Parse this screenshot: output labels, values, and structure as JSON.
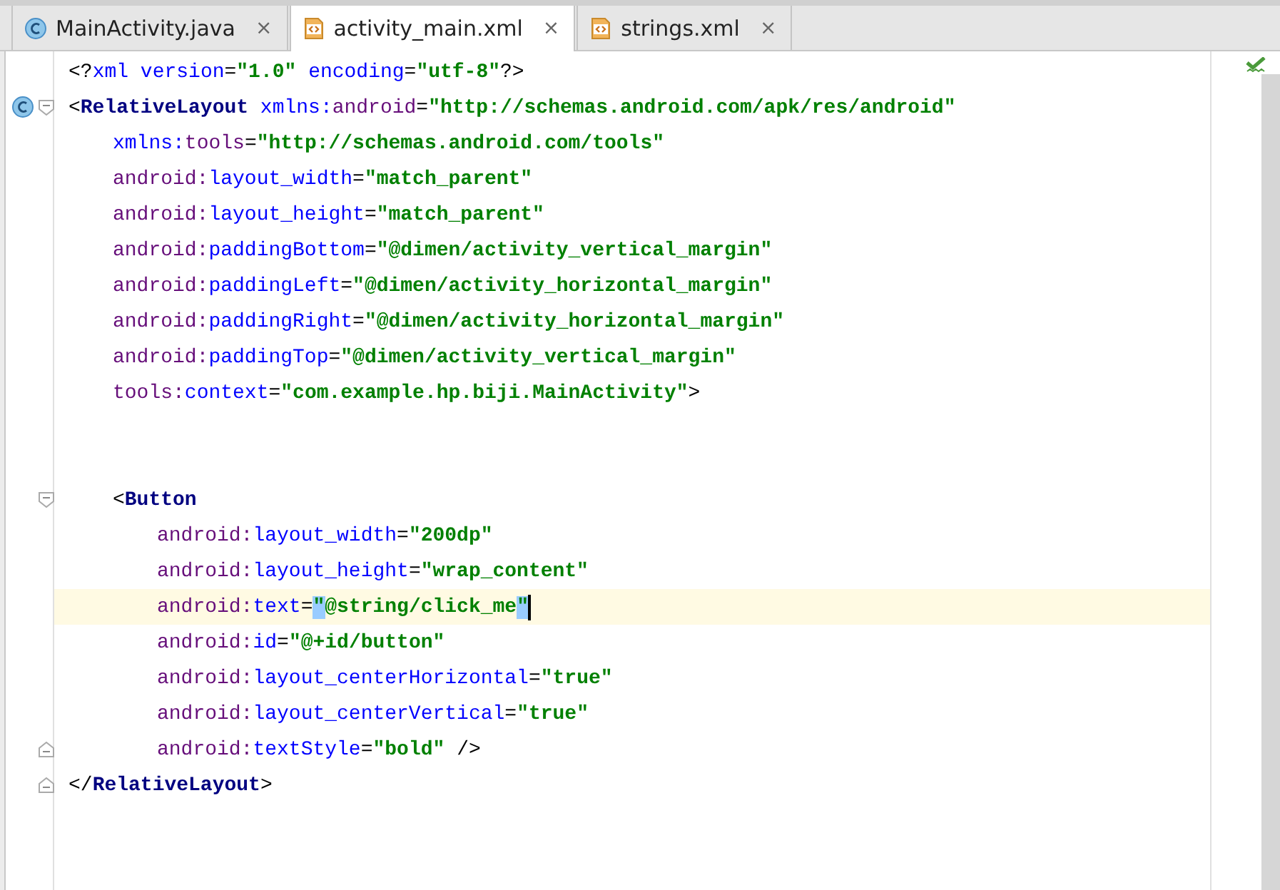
{
  "tabs": [
    {
      "label": "MainActivity.java",
      "kind": "java",
      "selected": false,
      "close": "×"
    },
    {
      "label": "activity_main.xml",
      "kind": "xml",
      "selected": true,
      "close": "×"
    },
    {
      "label": "strings.xml",
      "kind": "xml",
      "selected": false,
      "close": "×"
    }
  ],
  "editor": {
    "lines": [
      {
        "kind": "plain",
        "current": false,
        "tokens": [
          {
            "kind": "punct",
            "text": "<?"
          },
          {
            "kind": "attr",
            "text": "xml"
          },
          {
            "kind": "attr",
            "text": " version"
          },
          {
            "kind": "punct",
            "text": "="
          },
          {
            "kind": "value",
            "text": "\"1.0\""
          },
          {
            "kind": "attr",
            "text": " encoding"
          },
          {
            "kind": "punct",
            "text": "="
          },
          {
            "kind": "value",
            "text": "\"utf-8\""
          },
          {
            "kind": "punct",
            "text": "?>"
          }
        ]
      },
      {
        "kind": "class_fold_start",
        "current": false,
        "tokens": [
          {
            "kind": "punct",
            "text": "<"
          },
          {
            "kind": "tag",
            "text": "RelativeLayout"
          },
          {
            "kind": "attr",
            "text": " xmlns:"
          },
          {
            "kind": "ns",
            "text": "android"
          },
          {
            "kind": "punct",
            "text": "="
          },
          {
            "kind": "value",
            "text": "\"http://schemas.android.com/apk/res/android\""
          }
        ],
        "children": [
          {
            "kind": "plain",
            "current": false,
            "tokens": [
              {
                "kind": "attr",
                "text": "xmlns:"
              },
              {
                "kind": "ns",
                "text": "tools"
              },
              {
                "kind": "punct",
                "text": "="
              },
              {
                "kind": "value",
                "text": "\"http://schemas.android.com/tools\""
              }
            ]
          },
          {
            "kind": "plain",
            "current": false,
            "tokens": [
              {
                "kind": "ns",
                "text": "android:"
              },
              {
                "kind": "attr",
                "text": "layout_width"
              },
              {
                "kind": "punct",
                "text": "="
              },
              {
                "kind": "value",
                "text": "\"match_parent\""
              }
            ]
          },
          {
            "kind": "plain",
            "current": false,
            "tokens": [
              {
                "kind": "ns",
                "text": "android:"
              },
              {
                "kind": "attr",
                "text": "layout_height"
              },
              {
                "kind": "punct",
                "text": "="
              },
              {
                "kind": "value",
                "text": "\"match_parent\""
              }
            ]
          },
          {
            "kind": "plain",
            "current": false,
            "tokens": [
              {
                "kind": "ns",
                "text": "android:"
              },
              {
                "kind": "attr",
                "text": "paddingBottom"
              },
              {
                "kind": "punct",
                "text": "="
              },
              {
                "kind": "value",
                "text": "\"@dimen/activity_vertical_margin\""
              }
            ]
          },
          {
            "kind": "plain",
            "current": false,
            "tokens": [
              {
                "kind": "ns",
                "text": "android:"
              },
              {
                "kind": "attr",
                "text": "paddingLeft"
              },
              {
                "kind": "punct",
                "text": "="
              },
              {
                "kind": "value",
                "text": "\"@dimen/activity_horizontal_margin\""
              }
            ]
          },
          {
            "kind": "plain",
            "current": false,
            "tokens": [
              {
                "kind": "ns",
                "text": "android:"
              },
              {
                "kind": "attr",
                "text": "paddingRight"
              },
              {
                "kind": "punct",
                "text": "="
              },
              {
                "kind": "value",
                "text": "\"@dimen/activity_horizontal_margin\""
              }
            ]
          },
          {
            "kind": "plain",
            "current": false,
            "tokens": [
              {
                "kind": "ns",
                "text": "android:"
              },
              {
                "kind": "attr",
                "text": "paddingTop"
              },
              {
                "kind": "punct",
                "text": "="
              },
              {
                "kind": "value",
                "text": "\"@dimen/activity_vertical_margin\""
              }
            ]
          },
          {
            "kind": "plain",
            "current": false,
            "tokens": [
              {
                "kind": "ns",
                "text": "tools:"
              },
              {
                "kind": "attr",
                "text": "context"
              },
              {
                "kind": "punct",
                "text": "="
              },
              {
                "kind": "value",
                "text": "\"com.example.hp.biji.MainActivity\""
              },
              {
                "kind": "punct",
                "text": ">"
              }
            ]
          },
          {
            "kind": "plain",
            "current": false
          },
          {
            "kind": "plain",
            "current": false
          },
          {
            "kind": "fold_start",
            "current": false,
            "tokens": [
              {
                "kind": "punct",
                "text": "<"
              },
              {
                "kind": "tag",
                "text": "Button"
              }
            ],
            "children": [
              {
                "kind": "plain",
                "current": false,
                "tokens": [
                  {
                    "kind": "ns",
                    "text": "android:"
                  },
                  {
                    "kind": "attr",
                    "text": "layout_width"
                  },
                  {
                    "kind": "punct",
                    "text": "="
                  },
                  {
                    "kind": "value",
                    "text": "\"200dp\""
                  }
                ]
              },
              {
                "kind": "plain",
                "current": false,
                "tokens": [
                  {
                    "kind": "ns",
                    "text": "android:"
                  },
                  {
                    "kind": "attr",
                    "text": "layout_height"
                  },
                  {
                    "kind": "punct",
                    "text": "="
                  },
                  {
                    "kind": "value",
                    "text": "\"wrap_content\""
                  }
                ]
              },
              {
                "kind": "plain",
                "current": true,
                "tokens": [
                  {
                    "kind": "ns",
                    "text": "android:"
                  },
                  {
                    "kind": "attr",
                    "text": "text"
                  },
                  {
                    "kind": "punct",
                    "text": "="
                  },
                  {
                    "kind": "value",
                    "text": "\"@string/click_me\"",
                    "matched": true
                  }
                ]
              },
              {
                "kind": "plain",
                "current": false,
                "tokens": [
                  {
                    "kind": "ns",
                    "text": "android:"
                  },
                  {
                    "kind": "attr",
                    "text": "id"
                  },
                  {
                    "kind": "punct",
                    "text": "="
                  },
                  {
                    "kind": "value",
                    "text": "\"@+id/button\""
                  }
                ]
              },
              {
                "kind": "plain",
                "current": false,
                "tokens": [
                  {
                    "kind": "ns",
                    "text": "android:"
                  },
                  {
                    "kind": "attr",
                    "text": "layout_centerHorizontal"
                  },
                  {
                    "kind": "punct",
                    "text": "="
                  },
                  {
                    "kind": "value",
                    "text": "\"true\""
                  }
                ]
              },
              {
                "kind": "plain",
                "current": false,
                "tokens": [
                  {
                    "kind": "ns",
                    "text": "android:"
                  },
                  {
                    "kind": "attr",
                    "text": "layout_centerVertical"
                  },
                  {
                    "kind": "punct",
                    "text": "="
                  },
                  {
                    "kind": "value",
                    "text": "\"true\""
                  }
                ]
              },
              {
                "kind": "fold_end",
                "current": false,
                "tokens": [
                  {
                    "kind": "ns",
                    "text": "android:"
                  },
                  {
                    "kind": "attr",
                    "text": "textStyle"
                  },
                  {
                    "kind": "punct",
                    "text": "="
                  },
                  {
                    "kind": "value",
                    "text": "\"bold\""
                  },
                  {
                    "kind": "punct",
                    "text": " />"
                  }
                ]
              }
            ]
          }
        ]
      },
      {
        "kind": "fold_end",
        "current": false,
        "tokens": [
          {
            "kind": "punct",
            "text": "</"
          },
          {
            "kind": "tag",
            "text": "RelativeLayout"
          },
          {
            "kind": "punct",
            "text": ">"
          }
        ]
      }
    ]
  }
}
